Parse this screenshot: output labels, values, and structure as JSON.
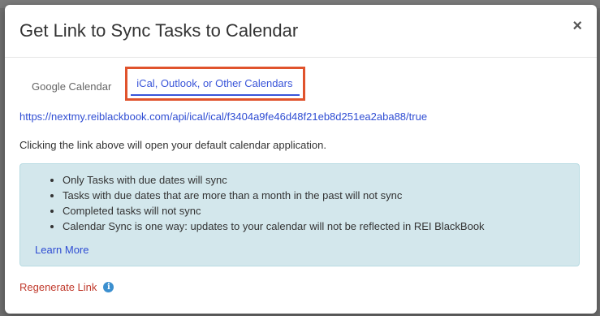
{
  "modal": {
    "title": "Get Link to Sync Tasks to Calendar",
    "close_label": "×"
  },
  "tabs": [
    {
      "label": "Google Calendar",
      "active": false
    },
    {
      "label": "iCal, Outlook, or Other Calendars",
      "active": true
    }
  ],
  "sync_url": "https://nextmy.reiblackbook.com/api/ical/ical/f3404a9fe46d48f21eb8d251ea2aba88/true",
  "helper_text": "Clicking the link above will open your default calendar application.",
  "info_box": {
    "items": [
      "Only Tasks with due dates will sync",
      "Tasks with due dates that are more than a month in the past will not sync",
      "Completed tasks will not sync",
      "Calendar Sync is one way: updates to your calendar will not be reflected in REI BlackBook"
    ],
    "learn_more_label": "Learn More"
  },
  "regenerate_label": "Regenerate Link",
  "info_icon_glyph": "i",
  "colors": {
    "accent_link": "#2f4dd3",
    "highlight_border": "#e0532c",
    "info_bg": "#d3e7ec",
    "danger_link": "#c0392b"
  }
}
